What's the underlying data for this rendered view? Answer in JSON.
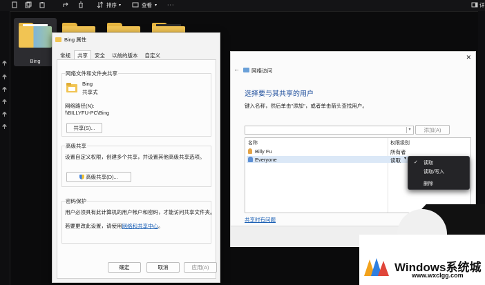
{
  "explorer": {
    "toolbar": {
      "sort_label": "排序",
      "view_label": "查看",
      "right_label": "详"
    },
    "folders": [
      {
        "name": "Bing"
      }
    ]
  },
  "properties_dialog": {
    "title": "Bing 属性",
    "tabs": [
      "常规",
      "共享",
      "安全",
      "以前的版本",
      "自定义"
    ],
    "active_tab": "共享",
    "network_section": {
      "heading": "网络文件和文件夹共享",
      "folder_name": "Bing",
      "folder_state": "共享式",
      "path_label": "网络路径(N):",
      "path_value": "\\\\BILLYFU-PC\\Bing",
      "share_button": "共享(S)..."
    },
    "advanced_section": {
      "heading": "高级共享",
      "description": "设置自定义权限，创建多个共享，并设置其他高级共享选项。",
      "button": "高级共享(D)..."
    },
    "password_section": {
      "heading": "密码保护",
      "description": "用户必须具有此计算机的用户帐户和密码，才能访问共享文件夹。",
      "change_prefix": "若要更改此设置，请使用",
      "change_link": "网络和共享中心",
      "change_suffix": "。"
    },
    "buttons": {
      "ok": "确定",
      "cancel": "取消",
      "apply": "应用(A)"
    }
  },
  "network_access": {
    "title": "网络访问",
    "heading": "选择要与其共享的用户",
    "instruction": "键入名称，然后单击\"添加\"，或者单击箭头查找用户。",
    "add_button": "添加(A)",
    "columns": {
      "name": "名称",
      "permission": "权限级别"
    },
    "users": [
      {
        "name": "Billy Fu",
        "permission": "所有者"
      },
      {
        "name": "Everyone",
        "permission": "读取"
      }
    ],
    "help_link": "共享时有问题",
    "context_menu": {
      "items": [
        "读取",
        "读取/写入",
        "删除"
      ],
      "checked": "读取"
    }
  },
  "watermark": {
    "brand": "Windows系统城",
    "url": "www.wxclgg.com"
  },
  "colors": {
    "link": "#1a5fb4",
    "accent": "#1a5fb4",
    "folder": "#f1c453",
    "dark_bg": "#0b0b0c"
  }
}
